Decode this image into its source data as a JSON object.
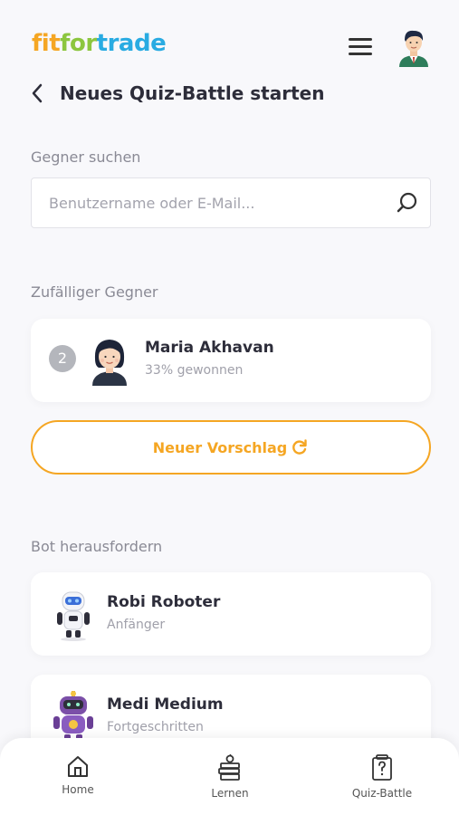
{
  "header": {
    "logo": {
      "part1": "fit",
      "part2": "for",
      "part3": "trade"
    },
    "menu_icon": "hamburger-icon",
    "avatar_icon": "user-avatar-icon"
  },
  "page": {
    "title": "Neues Quiz-Battle starten",
    "back_icon": "chevron-left-icon"
  },
  "search": {
    "label": "Gegner suchen",
    "placeholder": "Benutzername oder E-Mail...",
    "value": "",
    "icon": "search-icon"
  },
  "random_opponent": {
    "label": "Zufälliger Gegner",
    "rank": "2",
    "name": "Maria Akhavan",
    "stats": "33% gewonnen",
    "button_label": "Neuer Vorschlag",
    "button_icon": "refresh-icon"
  },
  "bots": {
    "label": "Bot herausfordern",
    "items": [
      {
        "name": "Robi Roboter",
        "level": "Anfänger",
        "icon": "robot-white-icon"
      },
      {
        "name": "Medi Medium",
        "level": "Fortgeschritten",
        "icon": "robot-purple-icon"
      }
    ]
  },
  "nav": {
    "items": [
      {
        "label": "Home",
        "icon": "home-icon"
      },
      {
        "label": "Lernen",
        "icon": "books-icon"
      },
      {
        "label": "Quiz-Battle",
        "icon": "quiz-icon"
      }
    ]
  },
  "colors": {
    "accent": "#f5a623",
    "logo_green": "#8cc63f",
    "logo_blue": "#29abe2",
    "background": "#f8f8fb"
  }
}
